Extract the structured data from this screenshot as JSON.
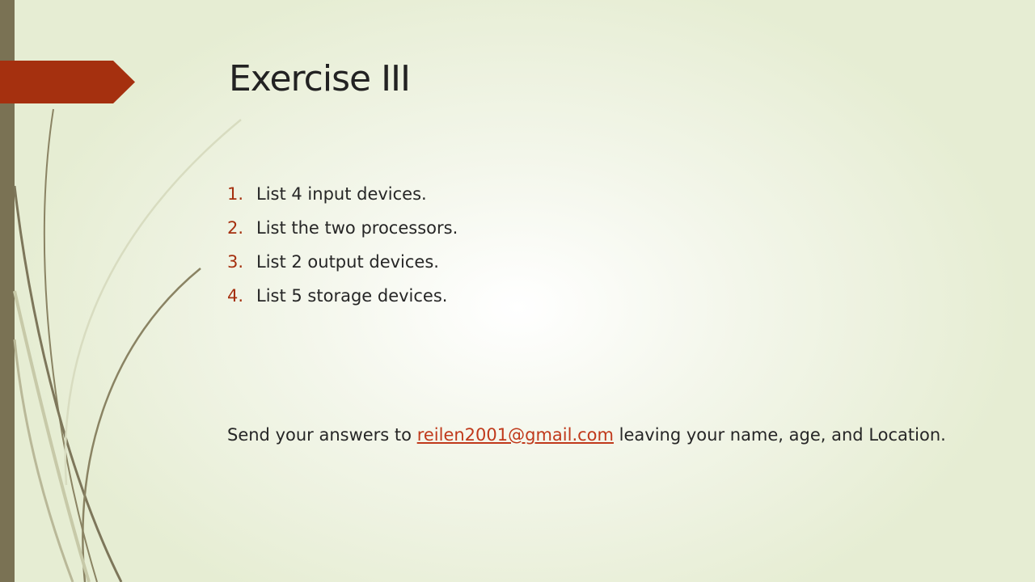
{
  "slide": {
    "title": "Exercise III",
    "items": [
      {
        "number": "1.",
        "text": "List 4 input devices."
      },
      {
        "number": "2.",
        "text": "List the two processors."
      },
      {
        "number": "3.",
        "text": "List 2 output devices."
      },
      {
        "number": "4.",
        "text": "List 5 storage devices."
      }
    ],
    "footer": {
      "prefix": "Send your answers to ",
      "email": "reilen2001@gmail.com",
      "suffix": " leaving your name, age, and Location."
    }
  },
  "colors": {
    "accent": "#a5300f",
    "left_bar": "#7a7254",
    "link": "#c0391b",
    "text": "#262626"
  }
}
